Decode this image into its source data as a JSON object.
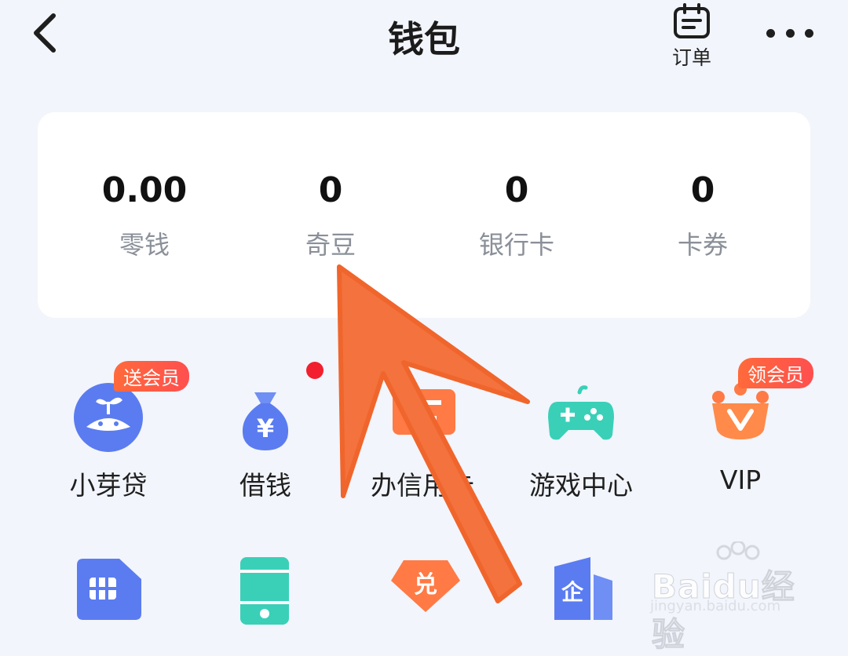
{
  "header": {
    "title": "钱包",
    "order_label": "订单"
  },
  "balances": [
    {
      "value": "0.00",
      "label": "零钱"
    },
    {
      "value": "0",
      "label": "奇豆"
    },
    {
      "value": "0",
      "label": "银行卡"
    },
    {
      "value": "0",
      "label": "卡券"
    }
  ],
  "services": [
    {
      "label": "小芽贷",
      "badge": "送会员",
      "icon": "sprout-icon"
    },
    {
      "label": "借钱",
      "icon": "money-bag-icon",
      "has_dot": true
    },
    {
      "label": "办信用卡",
      "icon": "credit-card-icon"
    },
    {
      "label": "游戏中心",
      "icon": "gamepad-icon"
    },
    {
      "label": "VIP",
      "badge": "领会员",
      "icon": "crown-icon"
    }
  ],
  "row2": [
    {
      "icon": "sim-card-icon"
    },
    {
      "icon": "phone-icon"
    },
    {
      "icon": "exchange-icon",
      "text": "兑"
    },
    {
      "icon": "enterprise-icon",
      "text": "企"
    }
  ],
  "watermark": {
    "main": "Baidu经验",
    "sub": "jingyan.baidu.com"
  },
  "colors": {
    "background": "#f2f5fb",
    "card": "#ffffff",
    "primary_blue": "#5b7cf0",
    "accent_orange": "#ff7a45",
    "teal": "#3ad0b8",
    "arrow": "#f3723d"
  }
}
